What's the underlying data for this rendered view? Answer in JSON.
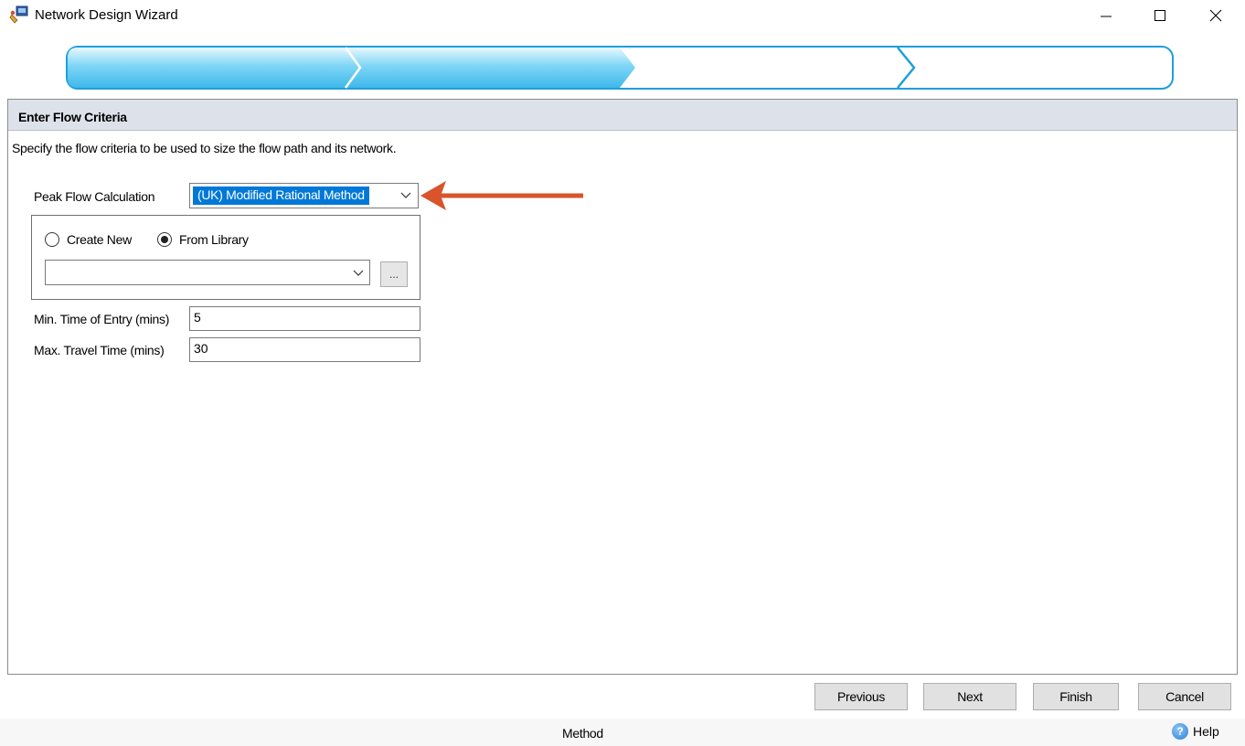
{
  "window": {
    "title": "Network Design Wizard",
    "icon": "network-wizard-icon",
    "controls": {
      "minimize": "minimize-icon",
      "maximize": "maximize-icon",
      "close": "close-icon"
    }
  },
  "progress": {
    "steps_total": 4,
    "steps_completed": 2,
    "active_color": "#4fc3ef",
    "border_color": "#1e9fdc"
  },
  "panel": {
    "title": "Enter Flow Criteria",
    "description": "Specify the flow criteria to be used to size the flow path and its network."
  },
  "form": {
    "peak_flow": {
      "label": "Peak Flow Calculation",
      "value": "(UK) Modified Rational Method"
    },
    "source": {
      "create_new": {
        "label": "Create New",
        "selected": false
      },
      "from_library": {
        "label": "From Library",
        "selected": true
      },
      "library_value": "",
      "browse_label": "..."
    },
    "min_time_entry": {
      "label": "Min. Time of Entry (mins)",
      "value": "5"
    },
    "max_travel_time": {
      "label": "Max. Travel Time (mins)",
      "value": "30"
    }
  },
  "annotation": {
    "arrow_color": "#d9532b"
  },
  "buttons": {
    "previous": "Previous",
    "next": "Next",
    "finish": "Finish",
    "cancel": "Cancel"
  },
  "status": {
    "text": "Method",
    "help": "Help"
  }
}
